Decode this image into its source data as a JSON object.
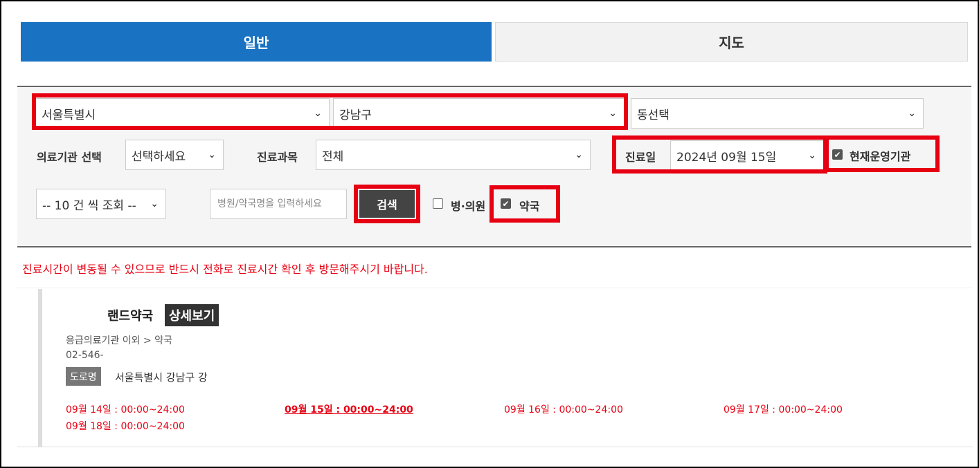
{
  "tabs": [
    {
      "label": "일반",
      "active": true
    },
    {
      "label": "지도",
      "active": false
    }
  ],
  "filters": {
    "sido": "서울특별시",
    "sigungu": "강남구",
    "dong": "동선택",
    "institution_label": "의료기관 선택",
    "institution_value": "선택하세요",
    "department_label": "진료과목",
    "department_value": "전체",
    "date_label": "진료일",
    "date_value": "2024년 09월 15일",
    "operating_now_label": "현재운영기관",
    "operating_now_checked": true,
    "page_size": "-- 10 건 씩 조회 --",
    "search_placeholder": "병원/약국명을 입력하세요",
    "search_button": "검색",
    "hospital_label": "병·의원",
    "hospital_checked": false,
    "pharmacy_label": "약국",
    "pharmacy_checked": true
  },
  "notice": "진료시간이 변동될 수 있으므로 반드시 전화로 진료시간 확인 후 방문해주시기 바랍니다.",
  "result": {
    "name": "랜드약국",
    "detail_button": "상세보기",
    "type": "응급의료기관 이외 > 약국",
    "phone": "02-546-",
    "road_badge": "도로명",
    "address": "서울특별시 강남구 강",
    "hours": [
      "09월 14일 : 00:00~24:00",
      "09월 15일 : 00:00~24:00",
      "09월 16일 : 00:00~24:00",
      "09월 17일 : 00:00~24:00",
      "09월 18일 : 00:00~24:00"
    ]
  },
  "colors": {
    "accent_blue": "#1a72c2",
    "highlight_red": "#e60012"
  }
}
